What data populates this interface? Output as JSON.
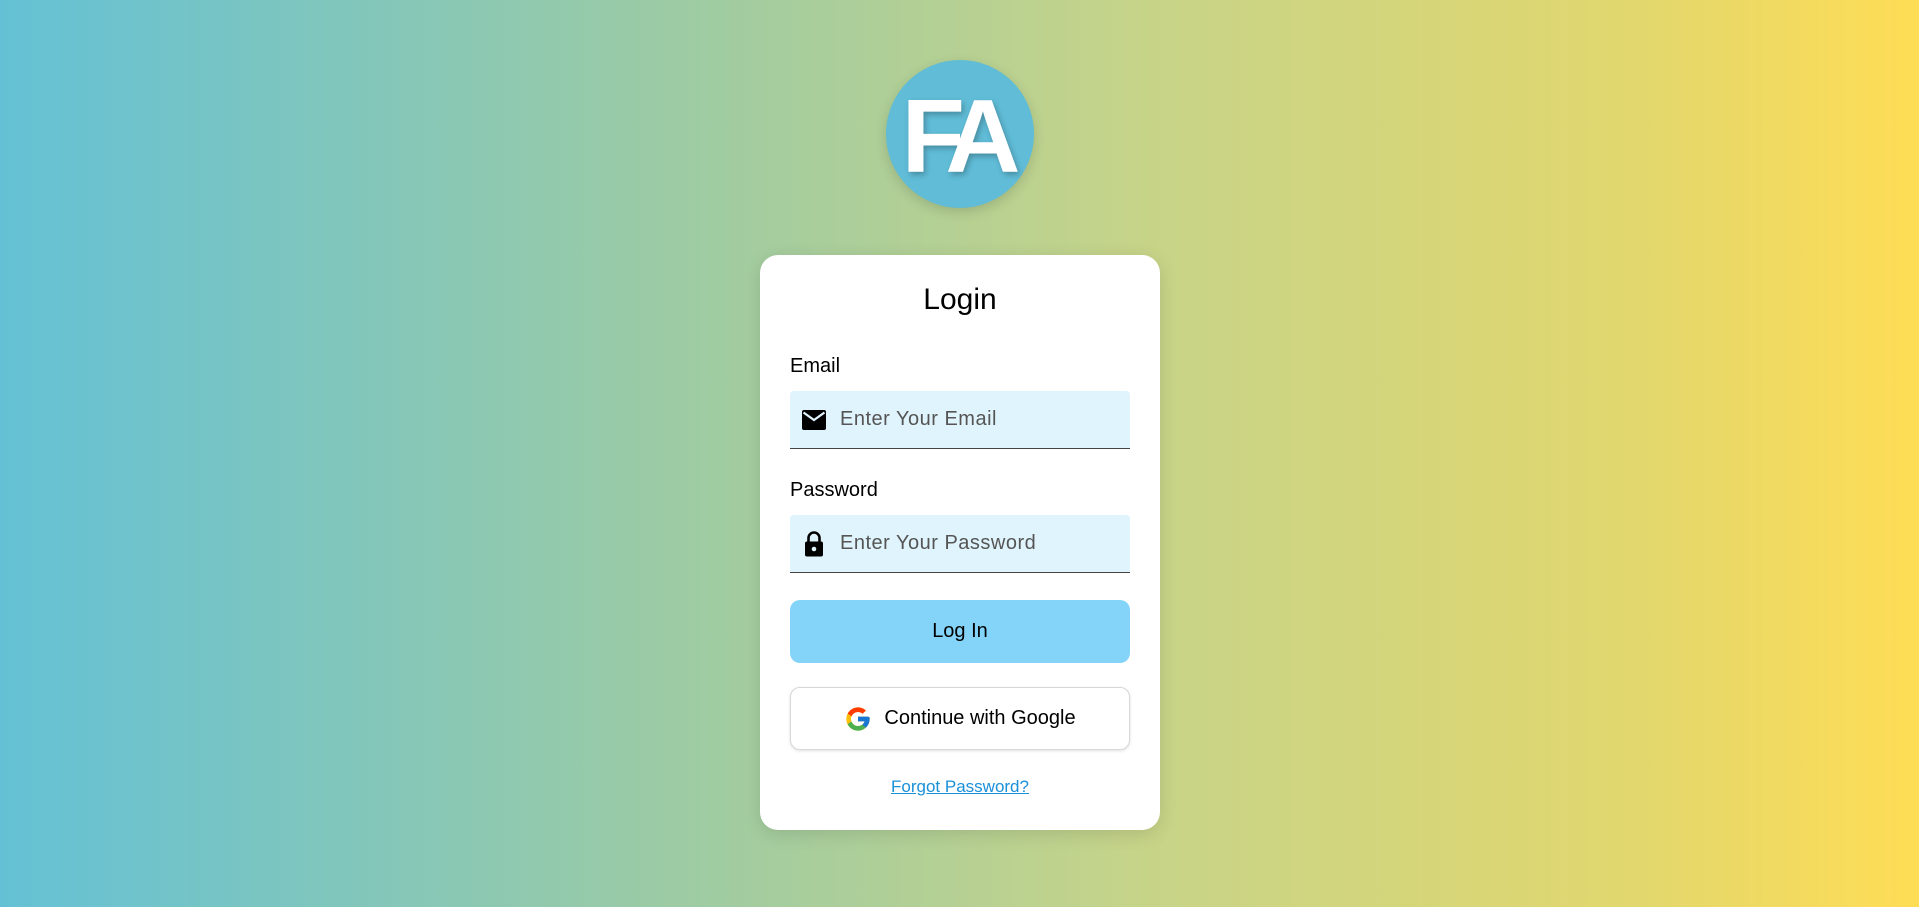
{
  "logo": {
    "text": "FA",
    "background_color": "#60bcd7"
  },
  "login_form": {
    "title": "Login",
    "email": {
      "label": "Email",
      "placeholder": "Enter Your Email",
      "value": "",
      "icon": "envelope-icon"
    },
    "password": {
      "label": "Password",
      "placeholder": "Enter Your Password",
      "value": "",
      "icon": "lock-icon"
    },
    "login_button_label": "Log In",
    "google_button_label": "Continue with Google",
    "forgot_password_label": "Forgot Password?"
  },
  "colors": {
    "field_background": "#e0f4fd",
    "login_button": "#83d4f8",
    "link": "#1a90d9",
    "gradient_start": "#64c1d5",
    "gradient_end": "#ffdd55"
  }
}
